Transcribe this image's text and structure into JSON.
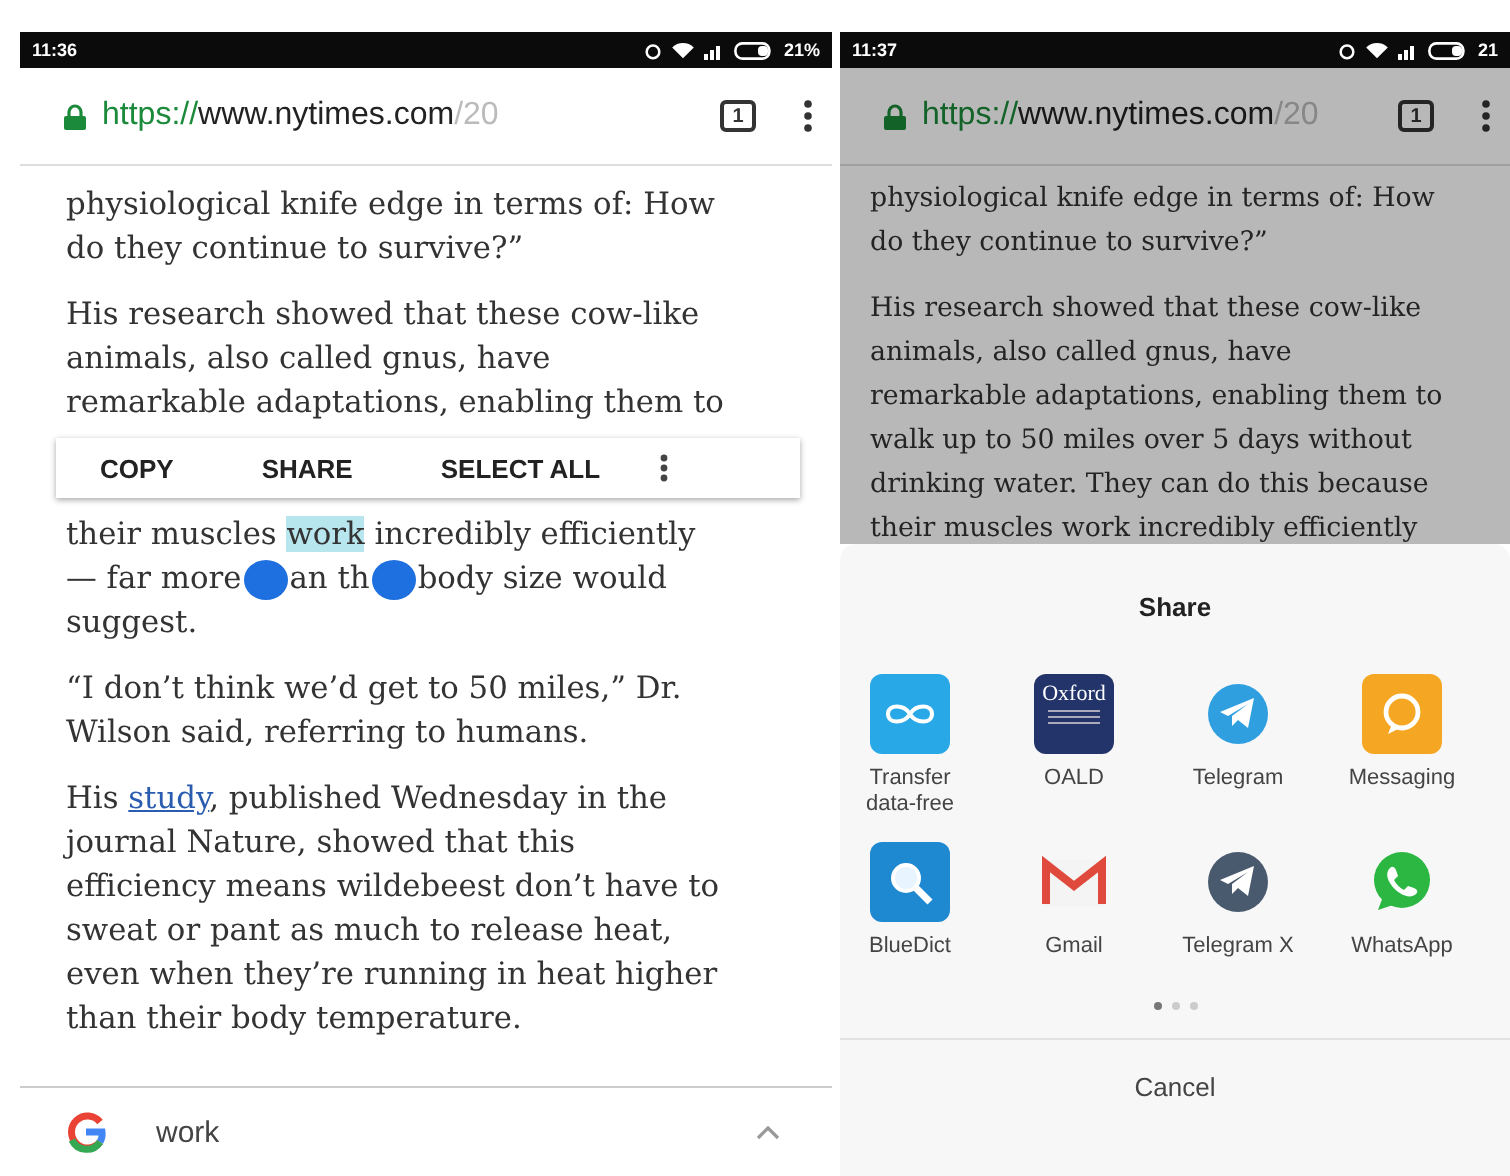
{
  "left_phone": {
    "status_bar": {
      "time": "11:36",
      "battery": "21%"
    },
    "url_bar": {
      "scheme": "https://",
      "host": "www.nytimes.com",
      "path": "/20",
      "tab_count": "1"
    },
    "blocks": [
      {
        "kind": "paragraph",
        "lines": [
          [
            {
              "kind": "text",
              "text": "physiological knife edge in terms of: How"
            }
          ],
          [
            {
              "kind": "text",
              "text": "do they continue to survive?”"
            }
          ]
        ]
      },
      {
        "kind": "paragraph",
        "lines": [
          [
            {
              "kind": "text",
              "text": "His research showed that these cow-like"
            }
          ],
          [
            {
              "kind": "text",
              "text": "animals, also called gnus, have"
            }
          ],
          [
            {
              "kind": "text",
              "text": "remarkable adaptations, enabling them to"
            }
          ]
        ]
      },
      {
        "kind": "toolbar",
        "actions": [
          "COPY",
          "SHARE",
          "SELECT ALL"
        ]
      },
      {
        "kind": "paragraph",
        "lines": [
          [
            {
              "kind": "text",
              "text": "their muscles "
            },
            {
              "kind": "selected",
              "text": "work"
            },
            {
              "kind": "text",
              "text": " incredibly efficiently"
            }
          ],
          [
            {
              "kind": "text",
              "text": "— far more"
            },
            {
              "kind": "handle"
            },
            {
              "kind": "text",
              "text": "an th"
            },
            {
              "kind": "handle"
            },
            {
              "kind": "text",
              "text": "body size would"
            }
          ],
          [
            {
              "kind": "text",
              "text": "suggest."
            }
          ]
        ]
      },
      {
        "kind": "paragraph",
        "lines": [
          [
            {
              "kind": "text",
              "text": "“I don’t think we’d get to 50 miles,” Dr."
            }
          ],
          [
            {
              "kind": "text",
              "text": "Wilson said, referring to humans."
            }
          ]
        ]
      },
      {
        "kind": "paragraph",
        "lines": [
          [
            {
              "kind": "text",
              "text": "His "
            },
            {
              "kind": "link",
              "text": "study"
            },
            {
              "kind": "text",
              "text": ", published Wednesday in the"
            }
          ],
          [
            {
              "kind": "text",
              "text": "journal Nature, showed that this"
            }
          ],
          [
            {
              "kind": "text",
              "text": "efficiency means wildebeest don’t have to"
            }
          ],
          [
            {
              "kind": "text",
              "text": "sweat or pant as much to release heat,"
            }
          ],
          [
            {
              "kind": "text",
              "text": "even when they’re running in heat higher"
            }
          ],
          [
            {
              "kind": "text",
              "text": "than their body temperature."
            }
          ]
        ]
      }
    ],
    "search_bar": {
      "query": "work"
    }
  },
  "right_phone": {
    "status_bar": {
      "time": "11:37",
      "battery": "21"
    },
    "url_bar": {
      "scheme": "https://",
      "host": "www.nytimes.com",
      "path": "/20",
      "tab_count": "1"
    },
    "lines": [
      [
        "physiological knife edge in terms of: How",
        "do they continue to survive?”"
      ],
      [
        "His research showed that these cow-like",
        "animals, also called gnus, have",
        "remarkable adaptations, enabling them to",
        "walk up to 50 miles over 5 days without",
        "drinking water. They can do this because",
        "their muscles work incredibly efficiently"
      ]
    ],
    "share_sheet": {
      "title": "Share",
      "apps": [
        {
          "kind": "infinity",
          "label": "Transfer data-free"
        },
        {
          "kind": "oxford",
          "label": "OALD",
          "icon_text": "Oxford"
        },
        {
          "kind": "telegram",
          "label": "Telegram"
        },
        {
          "kind": "messaging",
          "label": "Messaging"
        },
        {
          "kind": "dictionary",
          "label": "BlueDict"
        },
        {
          "kind": "gmail",
          "label": "Gmail"
        },
        {
          "kind": "telegram_x",
          "label": "Telegram X"
        },
        {
          "kind": "whatsapp",
          "label": "WhatsApp"
        }
      ],
      "pages": [
        {
          "selected": true
        },
        {
          "selected": false
        },
        {
          "selected": false
        }
      ],
      "cancel": "Cancel"
    }
  }
}
